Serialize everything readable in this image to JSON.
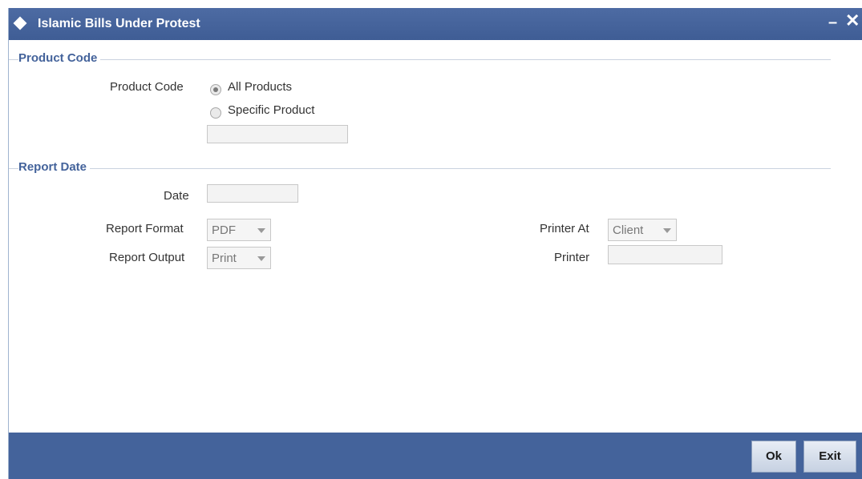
{
  "window": {
    "title": "Islamic Bills Under Protest",
    "minimize_glyph": "–",
    "close_glyph": "✕"
  },
  "product_code_section": {
    "heading": "Product Code",
    "field_label": "Product Code",
    "options": [
      {
        "label": "All Products",
        "checked": true
      },
      {
        "label": "Specific Product",
        "checked": false
      }
    ],
    "specific_product_value": ""
  },
  "report_date_section": {
    "heading": "Report Date",
    "date_label": "Date",
    "date_value": "",
    "report_format_label": "Report Format",
    "report_format_value": "PDF",
    "report_output_label": "Report Output",
    "report_output_value": "Print",
    "printer_at_label": "Printer At",
    "printer_at_value": "Client",
    "printer_label": "Printer",
    "printer_value": ""
  },
  "footer": {
    "ok_label": "Ok",
    "exit_label": "Exit"
  },
  "colors": {
    "titlebar": "#44639b",
    "section_heading": "#44639b",
    "footer": "#44639b"
  }
}
